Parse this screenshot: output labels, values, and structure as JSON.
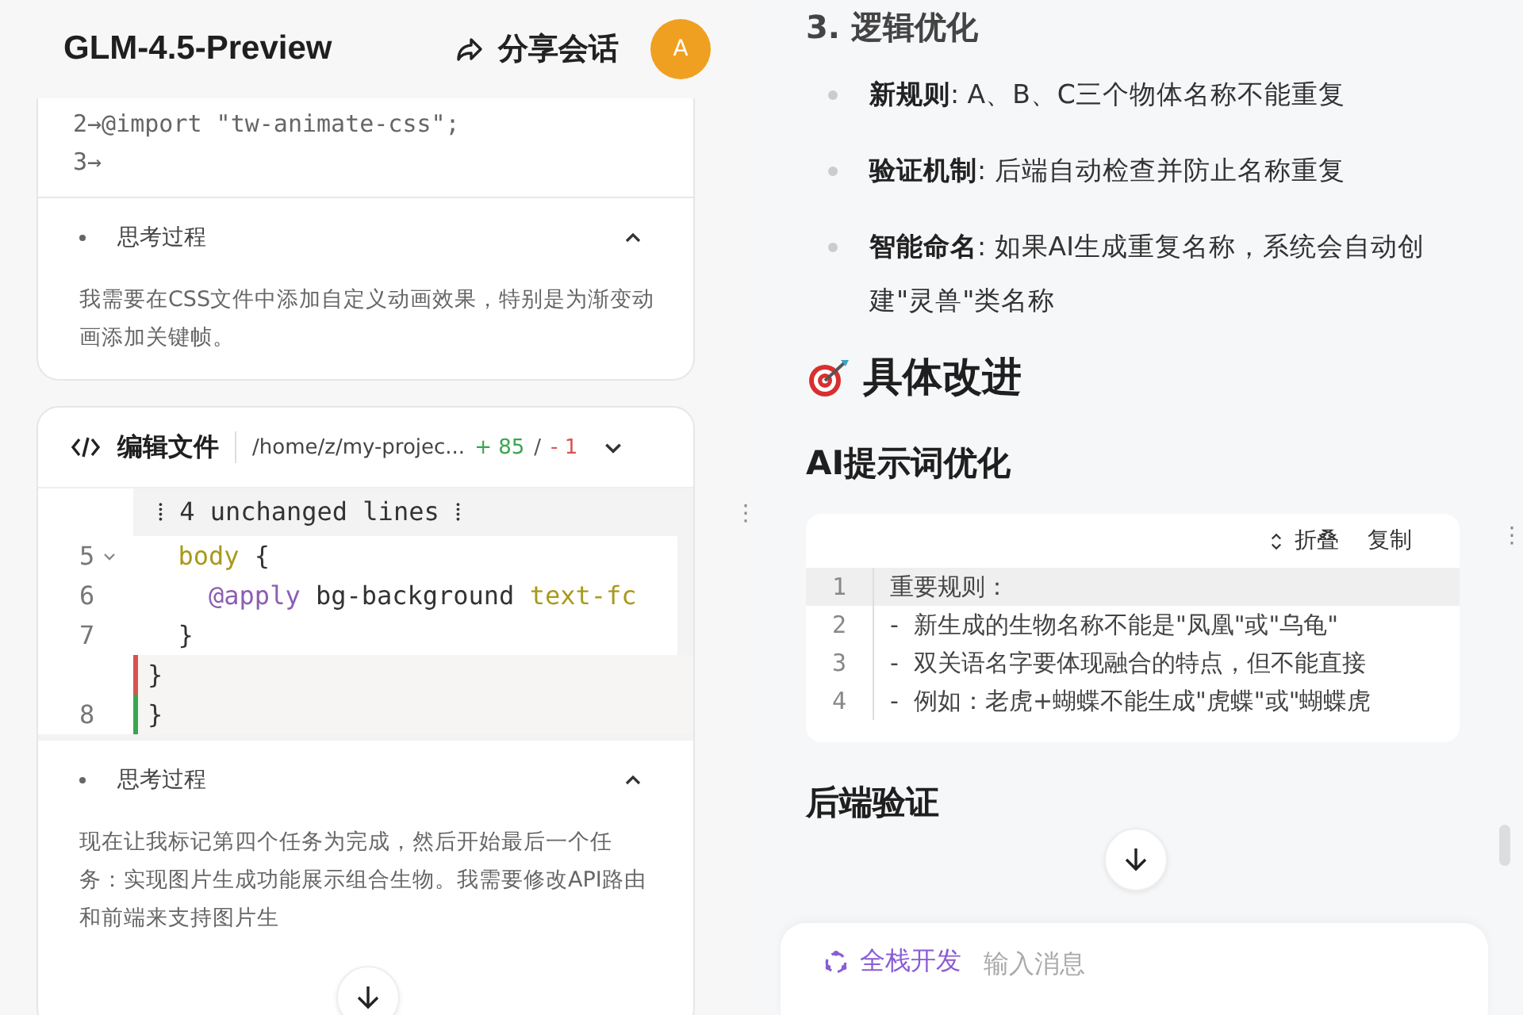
{
  "header": {
    "title": "GLM-4.5-Preview",
    "share_label": "分享会话",
    "avatar_letter": "A"
  },
  "file_card": {
    "code_lines": [
      "2→@import \"tw-animate-css\";",
      "3→"
    ],
    "thinking": {
      "title": "思考过程",
      "expanded": true,
      "text": "我需要在CSS文件中添加自定义动画效果，特别是为渐变动画添加关键帧。"
    }
  },
  "edit_card": {
    "title": "编辑文件",
    "path": "/home/z/my-projec...",
    "added": "+ 85",
    "separator": "/",
    "removed": "- 1",
    "expanded": true,
    "diff": [
      {
        "kind": "fold",
        "text": "⁞ 4 unchanged lines ⁞"
      },
      {
        "kind": "normal",
        "number": "5",
        "foldable": true,
        "tokens": [
          {
            "kind": "selector",
            "text": "  body"
          },
          {
            "kind": "plain",
            "text": " {"
          }
        ]
      },
      {
        "kind": "normal",
        "number": "6",
        "foldable": false,
        "tokens": [
          {
            "kind": "directive",
            "text": "    @apply"
          },
          {
            "kind": "plain",
            "text": " bg-background "
          },
          {
            "kind": "selector",
            "text": "text-fc"
          }
        ]
      },
      {
        "kind": "normal",
        "number": "7",
        "foldable": false,
        "tokens": [
          {
            "kind": "plain",
            "text": "  }"
          }
        ]
      },
      {
        "kind": "removed",
        "tokens": [
          {
            "kind": "plain",
            "text": "}"
          }
        ]
      },
      {
        "kind": "added",
        "number": "8",
        "foldable": false,
        "tokens": [
          {
            "kind": "plain",
            "text": "}"
          }
        ]
      }
    ],
    "thinking": {
      "title": "思考过程",
      "expanded": true,
      "text": "现在让我标记第四个任务为完成，然后开始最后一个任务：实现图片生成功能展示组合生物。我需要修改API路由和前端来支持图片生"
    }
  },
  "content": {
    "section_heading": "3. 逻辑优化",
    "bullets": [
      {
        "label": "新规则",
        "text": ": A、B、C三个物体名称不能重复"
      },
      {
        "label": "验证机制",
        "text": ": 后端自动检查并防止名称重复"
      },
      {
        "label": "智能命名",
        "text": ": 如果AI生成重复名称，系统会自动创建\"灵兽\"类名称"
      }
    ],
    "improve_heading": "具体改进",
    "prompt_heading": "AI提示词优化",
    "code_block": {
      "collapse_label": "折叠",
      "copy_label": "复制",
      "lines": [
        {
          "number": "1",
          "text": "重要规则：",
          "highlighted": true
        },
        {
          "number": "2",
          "text": "-  新生成的生物名称不能是\"凤凰\"或\"乌龟\"",
          "highlighted": false
        },
        {
          "number": "3",
          "text": "-  双关语名字要体现融合的特点，但不能直接",
          "highlighted": false
        },
        {
          "number": "4",
          "text": "-  例如：老虎+蝴蝶不能生成\"虎蝶\"或\"蝴蝶虎",
          "highlighted": false
        }
      ]
    },
    "backend_heading": "后端验证"
  },
  "handles": [
    "⋮",
    "⋮"
  ],
  "composer": {
    "mode_label": "全栈开发",
    "placeholder": "输入消息"
  }
}
